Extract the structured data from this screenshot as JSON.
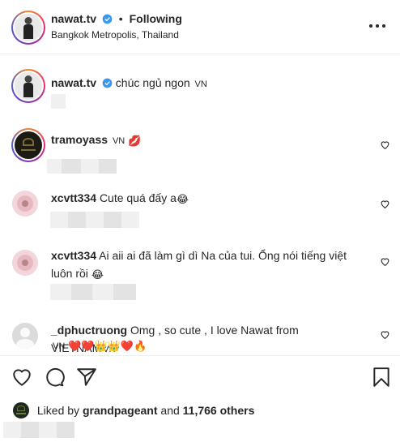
{
  "header": {
    "username": "nawat.tv",
    "separator": "•",
    "follow_status": "Following",
    "location": "Bangkok Metropolis, Thailand"
  },
  "caption": {
    "username": "nawat.tv",
    "text": "chúc ngủ ngon",
    "lang_tag": "VN"
  },
  "comments": [
    {
      "username": "tramoyass",
      "lang_tag": "VN",
      "emoji": "💋"
    },
    {
      "username": "xcvtt334",
      "text": "Cute quá đấy a",
      "emoji": "😂"
    },
    {
      "username": "xcvtt334",
      "text_line1": "Ai aii ai đã làm gì dì Na của tui. Ổng nói tiếng việt",
      "text_line2": "luôn rồi",
      "emoji": "😂"
    },
    {
      "username": "_dphuctruong",
      "text": "Omg , so cute , I love Nawat from VIETNAM",
      "lang_tag": "VN",
      "lang_tag2": "VN",
      "emojis": "❤️❤️👑👑❤️🔥"
    }
  ],
  "likes": {
    "prefix": "Liked by",
    "user": "grandpageant",
    "middle": "and",
    "count": "11,766 others"
  },
  "icons": {
    "verified": "verified-badge-icon",
    "more": "more-options-icon",
    "like": "heart-icon",
    "comment": "comment-icon",
    "share": "paper-plane-icon",
    "save": "bookmark-icon"
  },
  "colors": {
    "verified": "#3897f0",
    "heart_red": "#ed4956",
    "text": "#262626"
  }
}
